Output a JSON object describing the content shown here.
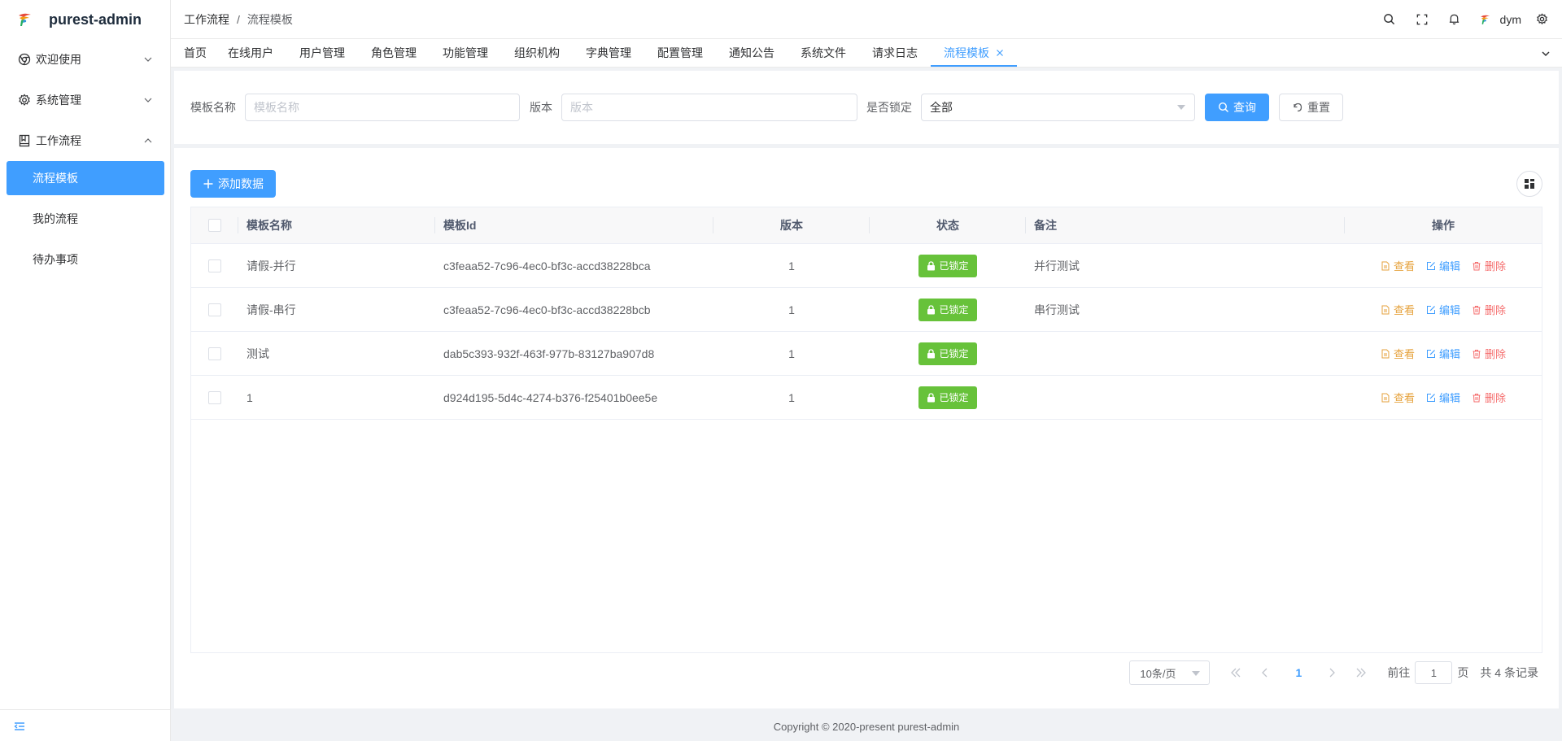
{
  "app": {
    "title": "purest-admin"
  },
  "sidebar": {
    "menus": [
      {
        "label": "欢迎使用",
        "icon": "chrome-icon",
        "expanded": false
      },
      {
        "label": "系统管理",
        "icon": "gear-icon",
        "expanded": false
      },
      {
        "label": "工作流程",
        "icon": "book-icon",
        "expanded": true
      }
    ],
    "submenu": [
      {
        "label": "流程模板",
        "active": true
      },
      {
        "label": "我的流程",
        "active": false
      },
      {
        "label": "待办事项",
        "active": false
      }
    ]
  },
  "header": {
    "breadcrumb": [
      "工作流程",
      "流程模板"
    ],
    "breadcrumb_sep": "/",
    "username": "dym"
  },
  "tabs": [
    {
      "label": "首页"
    },
    {
      "label": "在线用户"
    },
    {
      "label": "用户管理"
    },
    {
      "label": "角色管理"
    },
    {
      "label": "功能管理"
    },
    {
      "label": "组织机构"
    },
    {
      "label": "字典管理"
    },
    {
      "label": "配置管理"
    },
    {
      "label": "通知公告"
    },
    {
      "label": "系统文件"
    },
    {
      "label": "请求日志"
    },
    {
      "label": "流程模板",
      "active": true,
      "closable": true
    }
  ],
  "search": {
    "name_label": "模板名称",
    "name_placeholder": "模板名称",
    "version_label": "版本",
    "version_placeholder": "版本",
    "locked_label": "是否锁定",
    "locked_value": "全部",
    "query_button": "查询",
    "reset_button": "重置"
  },
  "toolbar": {
    "add_button": "添加数据"
  },
  "table": {
    "columns": [
      "模板名称",
      "模板Id",
      "版本",
      "状态",
      "备注",
      "操作"
    ],
    "rows": [
      {
        "name": "请假-并行",
        "id": "c3feaa52-7c96-4ec0-bf3c-accd38228bca",
        "version": "1",
        "status": "已锁定",
        "remark": "并行测试"
      },
      {
        "name": "请假-串行",
        "id": "c3feaa52-7c96-4ec0-bf3c-accd38228bcb",
        "version": "1",
        "status": "已锁定",
        "remark": "串行测试"
      },
      {
        "name": "测试",
        "id": "dab5c393-932f-463f-977b-83127ba907d8",
        "version": "1",
        "status": "已锁定",
        "remark": ""
      },
      {
        "name": "1",
        "id": "d924d195-5d4c-4274-b376-f25401b0ee5e",
        "version": "1",
        "status": "已锁定",
        "remark": ""
      }
    ],
    "actions": {
      "view": "查看",
      "edit": "编辑",
      "delete": "删除"
    }
  },
  "pagination": {
    "page_size": "10条/页",
    "current_page": "1",
    "goto_prefix": "前往",
    "goto_value": "1",
    "goto_suffix": "页",
    "total": "共 4 条记录"
  },
  "footer": {
    "copyright": "Copyright © 2020-present purest-admin"
  },
  "colors": {
    "primary": "#409eff",
    "success": "#67c23a",
    "warning": "#e6a23c",
    "danger": "#f56c6c"
  }
}
